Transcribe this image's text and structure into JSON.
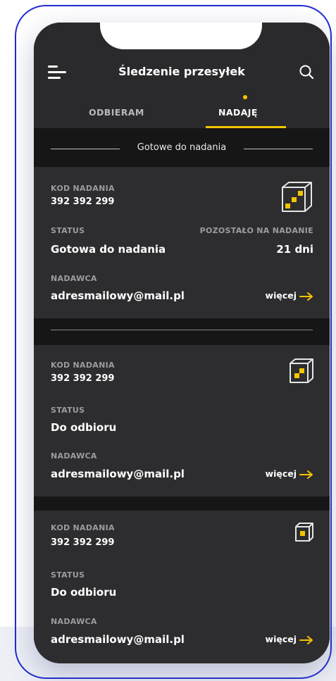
{
  "header": {
    "title": "Śledzenie przesyłek",
    "tabs": [
      {
        "label": "ODBIERAM",
        "active": false
      },
      {
        "label": "NADAJĘ",
        "active": true
      }
    ]
  },
  "section": {
    "title": "Gotowe do nadania"
  },
  "colors": {
    "accent": "#f5c400",
    "background": "#2a2a2c"
  },
  "cards": [
    {
      "code_label": "KOD NADANIA",
      "code": "392 392 299",
      "status_label": "STATUS",
      "status": "Gotowa do nadania",
      "remaining_label": "POZOSTAŁO NA NADANIE",
      "remaining": "21 dni",
      "sender_label": "NADAWCA",
      "sender": "adresmailowy@mail.pl",
      "more_label": "więcej",
      "icon": "parcel-locker-large-icon"
    },
    {
      "code_label": "KOD NADANIA",
      "code": "392 392 299",
      "status_label": "STATUS",
      "status": "Do odbioru",
      "sender_label": "NADAWCA",
      "sender": "adresmailowy@mail.pl",
      "more_label": "więcej",
      "icon": "parcel-locker-medium-icon"
    },
    {
      "code_label": "KOD NADANIA",
      "code": "392 392 299",
      "status_label": "STATUS",
      "status": "Do odbioru",
      "sender_label": "NADAWCA",
      "sender": "adresmailowy@mail.pl",
      "more_label": "więcej",
      "icon": "parcel-locker-small-icon"
    }
  ]
}
